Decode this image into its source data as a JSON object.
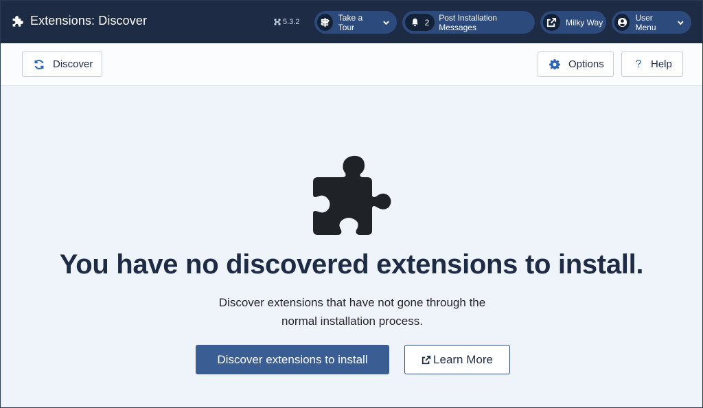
{
  "header": {
    "title": "Extensions: Discover",
    "version": "5.3.2",
    "tour_label": "Take a Tour",
    "messages_count": "2",
    "messages_label": "Post Installation Messages",
    "site_label": "Milky Way",
    "user_label": "User Menu"
  },
  "toolbar": {
    "discover_label": "Discover",
    "options_label": "Options",
    "help_label": "Help"
  },
  "empty_state": {
    "heading": "You have no discovered extensions to install.",
    "description": "Discover extensions that have not gone through the normal installation process.",
    "primary_button": "Discover extensions to install",
    "secondary_button": "Learn More"
  },
  "colors": {
    "header_bg": "#1d2b45",
    "pill_bg": "#2d4a7c",
    "primary_button": "#3a5e94",
    "page_bg": "#eff4fb",
    "icon_accent": "#2f64b0"
  },
  "icons": {
    "brand": "puzzle-icon",
    "tour": "signpost-icon",
    "messages": "bell-icon",
    "site": "external-link-icon",
    "user": "user-circle-icon",
    "discover": "refresh-icon",
    "options": "gear-icon",
    "help": "question-icon"
  }
}
